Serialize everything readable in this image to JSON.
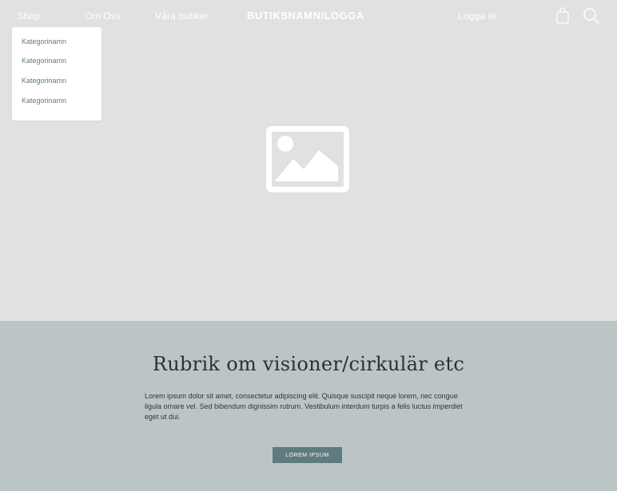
{
  "nav": {
    "shop": "Shop",
    "om_oss": "Om Oss",
    "vara_butiker": "Våra butiker",
    "logo": "BUTIKSNAMN/LOGGA",
    "login": "Logga in"
  },
  "icons": {
    "cart": "shopping-bag-icon",
    "search": "search-icon",
    "hero_image": "image-placeholder-icon"
  },
  "dropdown": {
    "items": [
      "Kategorinamn",
      "Kategorinamn",
      "Kategorinamn",
      "Kategorinamn"
    ]
  },
  "vision": {
    "title": "Rubrik om visioner/cirkulär etc",
    "body": "Lorem ipsum dolor sit amet, consectetur adipiscing elit. Quisque suscipit neque lorem, nec congue ligula ornare vel. Sed bibendum dignissim rutrum. Vestibulum interdum turpis a felis luctus imperdiet eget ut dui.",
    "button": "LOREM IPSUM"
  },
  "colors": {
    "hero_bg": "#e1e1e1",
    "vision_bg": "#bcc5c6",
    "accent": "#5e7b7d",
    "text_dark": "#2f2f2f"
  }
}
